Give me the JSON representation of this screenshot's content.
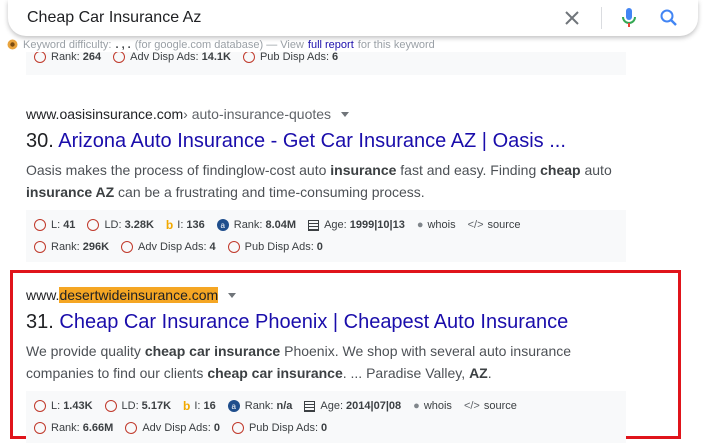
{
  "search": {
    "query": "Cheap Car Insurance Az"
  },
  "keyword_line": {
    "label": "Keyword difficulty:",
    "value": ". , .",
    "mid": "(for google.com database) — View",
    "link": "full report",
    "tail": "for this keyword"
  },
  "top_metrics": {
    "rank_label": "Rank:",
    "rank": "264",
    "adv_label": "Adv Disp Ads:",
    "adv": "14.1K",
    "pub_label": "Pub Disp Ads:",
    "pub": "6"
  },
  "results": [
    {
      "domain": "www.oasisinsurance.com",
      "path": " › auto-insurance-quotes",
      "number": "30.",
      "title": "Arizona Auto Insurance - Get Car Insurance AZ | Oasis ...",
      "snippet_html": "Oasis makes the process of findinglow-cost auto <b>insurance</b> fast and easy. Finding <b>cheap</b> auto <b>insurance AZ</b> can be a frustrating and time-consuming process.",
      "metrics": {
        "L_label": "L:",
        "L": "41",
        "LD_label": "LD:",
        "LD": "3.28K",
        "I_label": "I:",
        "I": "136",
        "rank_label": "Rank:",
        "rank": "8.04M",
        "age_label": "Age:",
        "age": "1999|10|13",
        "whois": "whois",
        "source": "source",
        "rank2_label": "Rank:",
        "rank2": "296K",
        "adv_label": "Adv Disp Ads:",
        "adv": "4",
        "pub_label": "Pub Disp Ads:",
        "pub": "0"
      }
    },
    {
      "domain_prefix": "www.",
      "domain_highlight": "desertwideinsurance.com",
      "number": "31.",
      "title": "Cheap Car Insurance Phoenix | Cheapest Auto Insurance",
      "snippet_html": "We provide quality <b>cheap car insurance</b> Phoenix. We shop with several auto insurance companies to find our clients <b>cheap car insurance</b>. ... Paradise Valley, <b>AZ</b>.",
      "metrics": {
        "L_label": "L:",
        "L": "1.43K",
        "LD_label": "LD:",
        "LD": "5.17K",
        "I_label": "I:",
        "I": "16",
        "rank_label": "Rank:",
        "rank": "n/a",
        "age_label": "Age:",
        "age": "2014|07|08",
        "whois": "whois",
        "source": "source",
        "rank2_label": "Rank:",
        "rank2": "6.66M",
        "adv_label": "Adv Disp Ads:",
        "adv": "0",
        "pub_label": "Pub Disp Ads:",
        "pub": "0"
      }
    }
  ],
  "colors": {
    "link": "#1a0dab",
    "highlight": "#f5a623",
    "box": "#e0141b",
    "metric_circle": "#c0392b"
  }
}
